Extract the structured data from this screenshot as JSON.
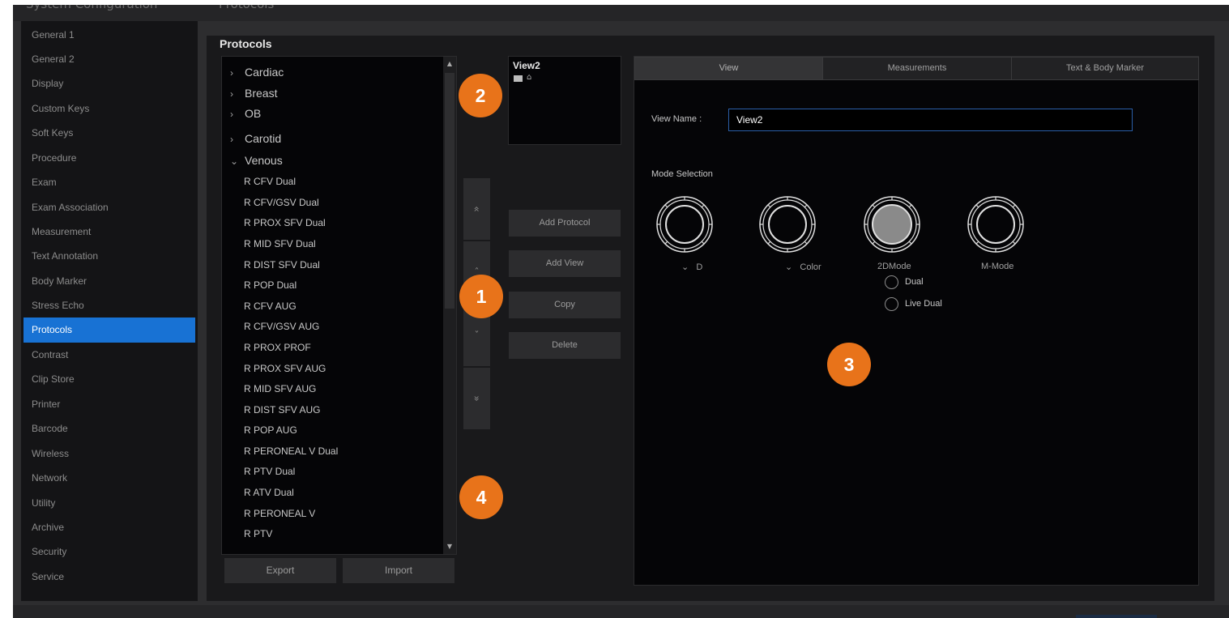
{
  "header": {
    "window_title": "System Configuration",
    "page_title": "Protocols"
  },
  "sidebar": {
    "active": "Protocols",
    "items": [
      {
        "label": "General 1"
      },
      {
        "label": "General 2"
      },
      {
        "label": "Display"
      },
      {
        "label": "Custom Keys"
      },
      {
        "label": "Soft Keys"
      },
      {
        "label": "Procedure"
      },
      {
        "label": "Exam"
      },
      {
        "label": "Exam Association"
      },
      {
        "label": "Measurement"
      },
      {
        "label": "Text Annotation"
      },
      {
        "label": "Body Marker"
      },
      {
        "label": "Stress Echo"
      },
      {
        "label": "Protocols"
      },
      {
        "label": "Contrast"
      },
      {
        "label": "Clip Store"
      },
      {
        "label": "Printer"
      },
      {
        "label": "Barcode"
      },
      {
        "label": "Wireless"
      },
      {
        "label": "Network"
      },
      {
        "label": "Utility"
      },
      {
        "label": "Archive"
      },
      {
        "label": "Security"
      },
      {
        "label": "Service"
      }
    ]
  },
  "main": {
    "title": "Protocols",
    "tree": {
      "groups": [
        {
          "label": "Cardiac",
          "chevron": "›"
        },
        {
          "label": "Breast",
          "chevron": "›"
        },
        {
          "label": "OB",
          "chevron": "›"
        },
        {
          "label": "Carotid",
          "chevron": "›"
        },
        {
          "label": "Venous",
          "chevron": "⌄"
        }
      ],
      "venous_children": [
        "R CFV Dual",
        "R CFV/GSV Dual",
        "R PROX SFV Dual",
        "R MID SFV Dual",
        "R DIST SFV Dual",
        "R POP Dual",
        "R CFV AUG",
        "R CFV/GSV AUG",
        "R PROX PROF",
        "R PROX SFV AUG",
        "R MID SFV AUG",
        "R DIST SFV AUG",
        "R POP AUG",
        "R PERONEAL V Dual",
        "R PTV Dual",
        "R ATV Dual",
        "R PERONEAL V",
        "R PTV"
      ]
    },
    "export_label": "Export",
    "import_label": "Import",
    "move_icons": {
      "top": "«",
      "up": "ˆ",
      "down": "ˇ",
      "bottom": "»"
    },
    "view_preview": {
      "title": "View2",
      "thumb_icon": "⌂"
    },
    "actions": {
      "add_protocol": "Add Protocol",
      "add_view": "Add View",
      "copy": "Copy",
      "delete": "Delete"
    }
  },
  "view_panel": {
    "tabs": [
      {
        "label": "View"
      },
      {
        "label": "Measurements"
      },
      {
        "label": "Text & Body Marker"
      }
    ],
    "active_tab": "View",
    "view_name_label": "View Name :",
    "view_name_value": "View2",
    "mode_selection_label": "Mode Selection",
    "modes": [
      {
        "label": "D",
        "chevron": "⌄",
        "selected": false
      },
      {
        "label": "Color",
        "chevron": "⌄",
        "selected": false
      },
      {
        "label": "2DMode",
        "chevron": "",
        "selected": true
      },
      {
        "label": "M-Mode",
        "chevron": "",
        "selected": false
      }
    ],
    "options": [
      {
        "label": "Dual"
      },
      {
        "label": "Live Dual"
      }
    ]
  },
  "callouts": {
    "c1": "1",
    "c2": "2",
    "c3": "3",
    "c4": "4",
    "color": "#e8731a"
  },
  "colors": {
    "accent": "#1872d4",
    "input_border": "#2b5fa8",
    "panel_bg": "#050507"
  }
}
